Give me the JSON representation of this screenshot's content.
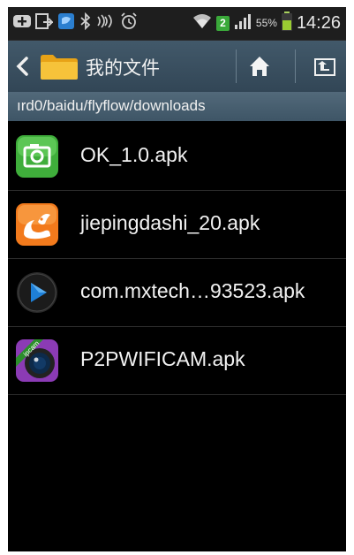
{
  "status_bar": {
    "time": "14:26",
    "battery_percent": "55%",
    "notification_badge": "2",
    "icons": [
      "add-icon",
      "screenshot-icon",
      "app-notification-icon",
      "bluetooth-icon",
      "nfc-icon",
      "alarm-icon",
      "wifi-icon",
      "signal-icon",
      "battery-icon"
    ]
  },
  "action_bar": {
    "title": "我的文件",
    "back_icon": "back-arrow-icon",
    "folder_icon": "folder-icon",
    "home_icon": "home-icon",
    "up_icon": "up-directory-icon"
  },
  "path_bar": {
    "path": "ırd0/baidu/flyflow/downloads"
  },
  "files": [
    {
      "name": "OK_1.0.apk",
      "icon": "camera-app-icon",
      "icon_color": "#3fae3b"
    },
    {
      "name": "jiepingdashi_20.apk",
      "icon": "uc-squirrel-app-icon",
      "icon_color": "#f27a1c"
    },
    {
      "name": "com.mxtech…93523.apk",
      "icon": "mx-player-icon",
      "icon_color": "#1e7fd6"
    },
    {
      "name": "P2PWIFICAM.apk",
      "icon": "ipcam-lens-icon",
      "icon_color": "#8b3bb5"
    }
  ],
  "colors": {
    "action_bar": "#3a5060",
    "path_bar": "#4a6172",
    "background": "#000000",
    "text": "#f2f2f2"
  }
}
